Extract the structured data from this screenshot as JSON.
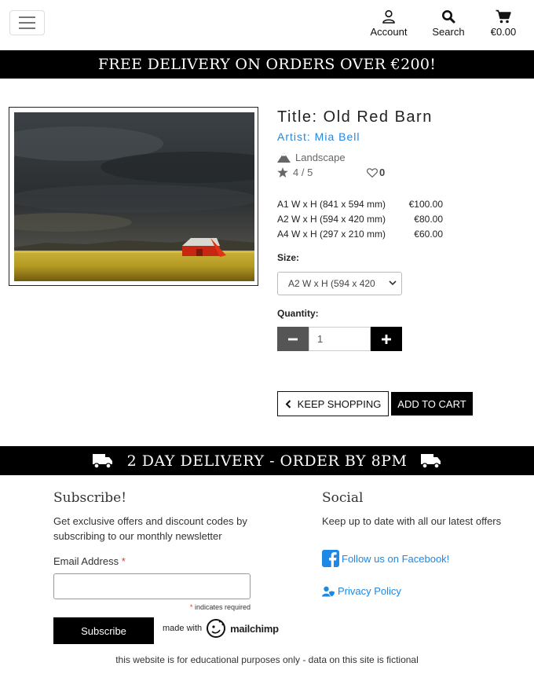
{
  "header": {
    "menu_icon": "hamburger-icon",
    "account_label": "Account",
    "search_label": "Search",
    "cart_total": "€0.00"
  },
  "promo_banner": "FREE DELIVERY ON ORDERS OVER €200!",
  "product": {
    "title": "Title: Old Red Barn",
    "artist": "Artist: Mia Bell",
    "category": "Landscape",
    "rating": "4 / 5",
    "likes": "0",
    "prices": [
      {
        "size": "A1 W x H (841 x 594 mm)",
        "price": "€100.00"
      },
      {
        "size": "A2 W x H (594 x 420 mm)",
        "price": "€80.00"
      },
      {
        "size": "A4 W x H (297 x 210 mm)",
        "price": "€60.00"
      }
    ],
    "size_label": "Size:",
    "size_selected": "A2 W x H (594 x 420",
    "quantity_label": "Quantity:",
    "quantity_value": "1",
    "keep_shopping_label": "KEEP SHOPPING",
    "add_to_cart_label": "ADD TO CART"
  },
  "delivery_banner": "2 DAY DELIVERY - ORDER BY 8PM",
  "footer": {
    "subscribe_heading": "Subscribe!",
    "subscribe_text": "Get exclusive offers and discount codes by subscribing to our monthly newsletter",
    "email_label": "Email Address",
    "required_mark": "*",
    "required_note": "indicates required",
    "subscribe_button": "Subscribe",
    "made_with": "made with",
    "mailchimp": "mailchimp",
    "social_heading": "Social",
    "social_text": "Keep up to date with all our latest offers",
    "facebook_link": "Follow us on Facebook!",
    "privacy_link": "Privacy Policy",
    "disclaimer": "this website is for educational purposes only - data on this site is fictional"
  },
  "colors": {
    "accent_link": "#1e88e5",
    "banner_bg": "#000000",
    "required": "#e53935"
  }
}
